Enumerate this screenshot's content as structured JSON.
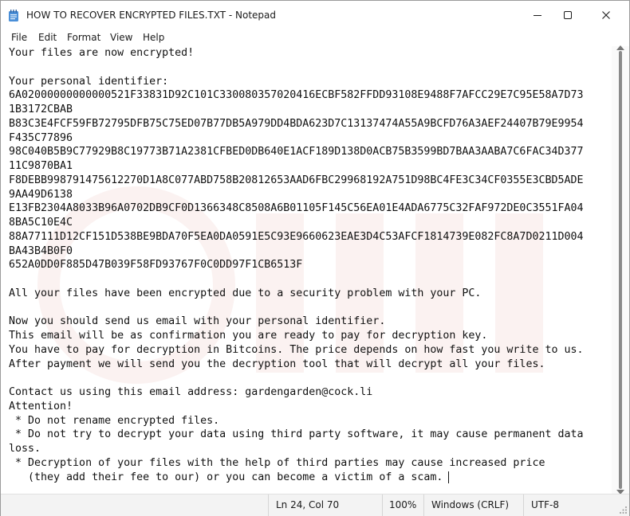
{
  "window": {
    "title": "HOW TO RECOVER ENCRYPTED FILES.TXT - Notepad",
    "icons": {
      "app": "notepad-icon",
      "minimize": "minimize-icon",
      "maximize": "maximize-icon",
      "close": "close-icon"
    }
  },
  "menu": {
    "file": "File",
    "edit": "Edit",
    "format": "Format",
    "view": "View",
    "help": "Help"
  },
  "document": {
    "lines": [
      "Your files are now encrypted!",
      "",
      "Your personal identifier:",
      "6A02000000000000521F33831D92C101C330080357020416ECBF582FFDD93108E9488F7AFCC29E7C95E58A7D73",
      "1B3172CBAB",
      "B83C3E4FCF59FB72795DFB75C75ED07B77DB5A979DD4BDA623D7C13137474A55A9BCFD76A3AEF24407B79E9954",
      "F435C77896",
      "98C040B5B9C77929B8C19773B71A2381CFBED0DB640E1ACF189D138D0ACB75B3599BD7BAA3AABA7C6FAC34D377",
      "11C9870BA1",
      "F8DEBB998791475612270D1A8C077ABD758B20812653AAD6FBC29968192A751D98BC4FE3C34CF0355E3CBD5ADE",
      "9AA49D6138",
      "E13FB2304A8033B96A0702DB9CF0D1366348C8508A6B01105F145C56EA01E4ADA6775C32FAF972DE0C3551FA04",
      "8BA5C10E4C",
      "88A77111D12CF151D538BE9BDA70F5EA0DA0591E5C93E9660623EAE3D4C53AFCF1814739E082FC8A7D0211D004",
      "BA43B4B0F0",
      "652A0DD0F885D47B039F58FD93767F0C0DD97F1CB6513F",
      "",
      "All your files have been encrypted due to a security problem with your PC.",
      "",
      "Now you should send us email with your personal identifier.",
      "This email will be as confirmation you are ready to pay for decryption key.",
      "You have to pay for decryption in Bitcoins. The price depends on how fast you write to us.",
      "After payment we will send you the decryption tool that will decrypt all your files.",
      "",
      "Contact us using this email address: gardengarden@cock.li",
      "Attention!",
      " * Do not rename encrypted files.",
      " * Do not try to decrypt your data using third party software, it may cause permanent data",
      "loss.",
      " * Decryption of your files with the help of third parties may cause increased price",
      "   (they add their fee to our) or you can become a victim of a scam."
    ]
  },
  "status": {
    "position": "Ln 24, Col 70",
    "zoom": "100%",
    "line_ending": "Windows (CRLF)",
    "encoding": "UTF-8"
  },
  "colors": {
    "background": "#ffffff",
    "text": "#111111",
    "statusbar": "#f3f3f3",
    "notepad_icon": "#4a8fd8"
  }
}
